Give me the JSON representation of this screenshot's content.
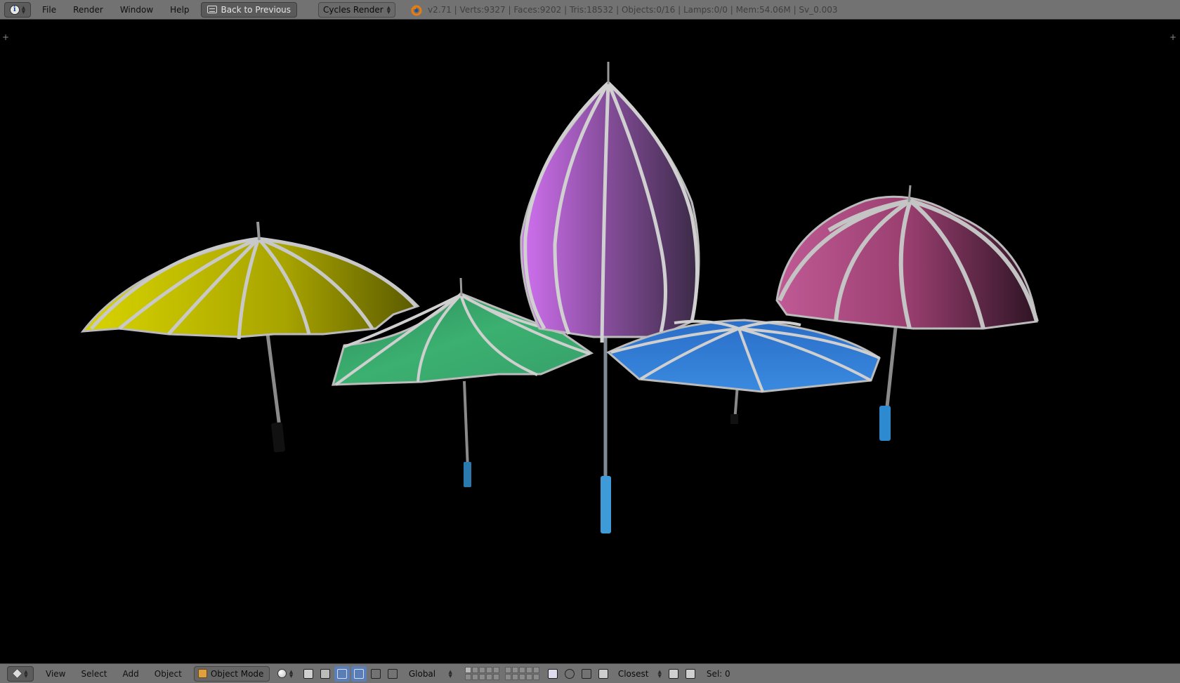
{
  "top_bar": {
    "menus": [
      "File",
      "Render",
      "Window",
      "Help"
    ],
    "back_button": "Back to Previous",
    "render_engine": "Cycles Render",
    "stats": "v2.71 | Verts:9327 | Faces:9202 | Tris:18532 | Objects:0/16 | Lamps:0/0 | Mem:54.06M | Sv_0.003"
  },
  "bottom_bar": {
    "menus": [
      "View",
      "Select",
      "Add",
      "Object"
    ],
    "mode": "Object Mode",
    "orientation": "Global",
    "snap_target": "Closest",
    "selection": "Sel: 0"
  },
  "scene": {
    "background": "#000000",
    "umbrellas": [
      {
        "name": "yellow-umbrella",
        "color": "#c9c400"
      },
      {
        "name": "green-umbrella",
        "color": "#3aa86a"
      },
      {
        "name": "purple-umbrella",
        "color": "#9a5ab8"
      },
      {
        "name": "blue-umbrella",
        "color": "#3a86d8"
      },
      {
        "name": "pink-umbrella",
        "color": "#b04a7e"
      }
    ]
  }
}
